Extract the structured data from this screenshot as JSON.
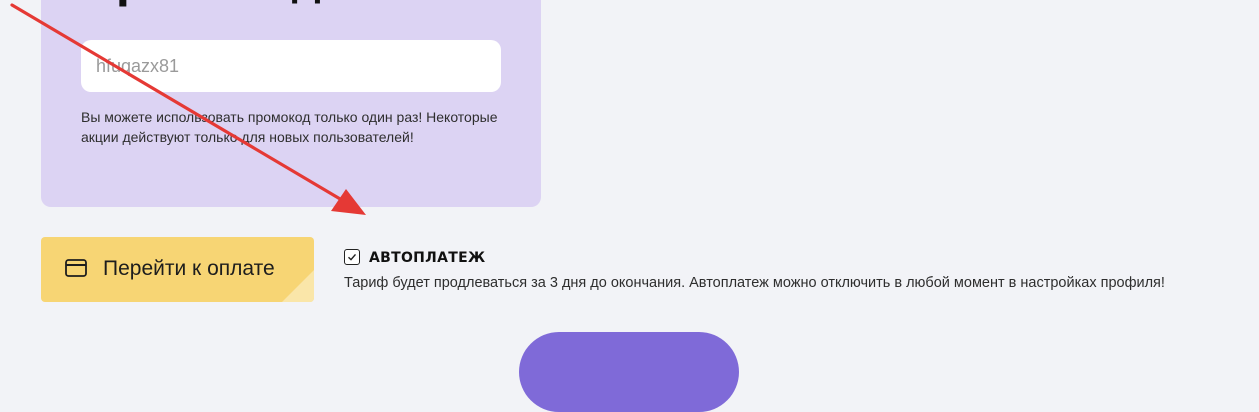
{
  "promo": {
    "title": "Промокод",
    "input_value": "hfuqazx81",
    "note": "Вы можете использовать промокод только один раз! Некоторые акции действуют только для новых пользователей!"
  },
  "payment": {
    "button_label": "Перейти к оплате",
    "icon": "credit-card-icon"
  },
  "autopay": {
    "checked": true,
    "title": "АВТОПЛАТЕЖ",
    "description": "Тариф будет продлеваться за 3 дня до окончания. Автоплатеж можно отключить в любой момент в настройках профиля!"
  },
  "colors": {
    "page_bg": "#f2f3f7",
    "promo_card_bg": "#dcd3f3",
    "pay_button": "#f7d574",
    "next_button": "#7f6ad8",
    "annotation_arrow": "#e53935"
  }
}
